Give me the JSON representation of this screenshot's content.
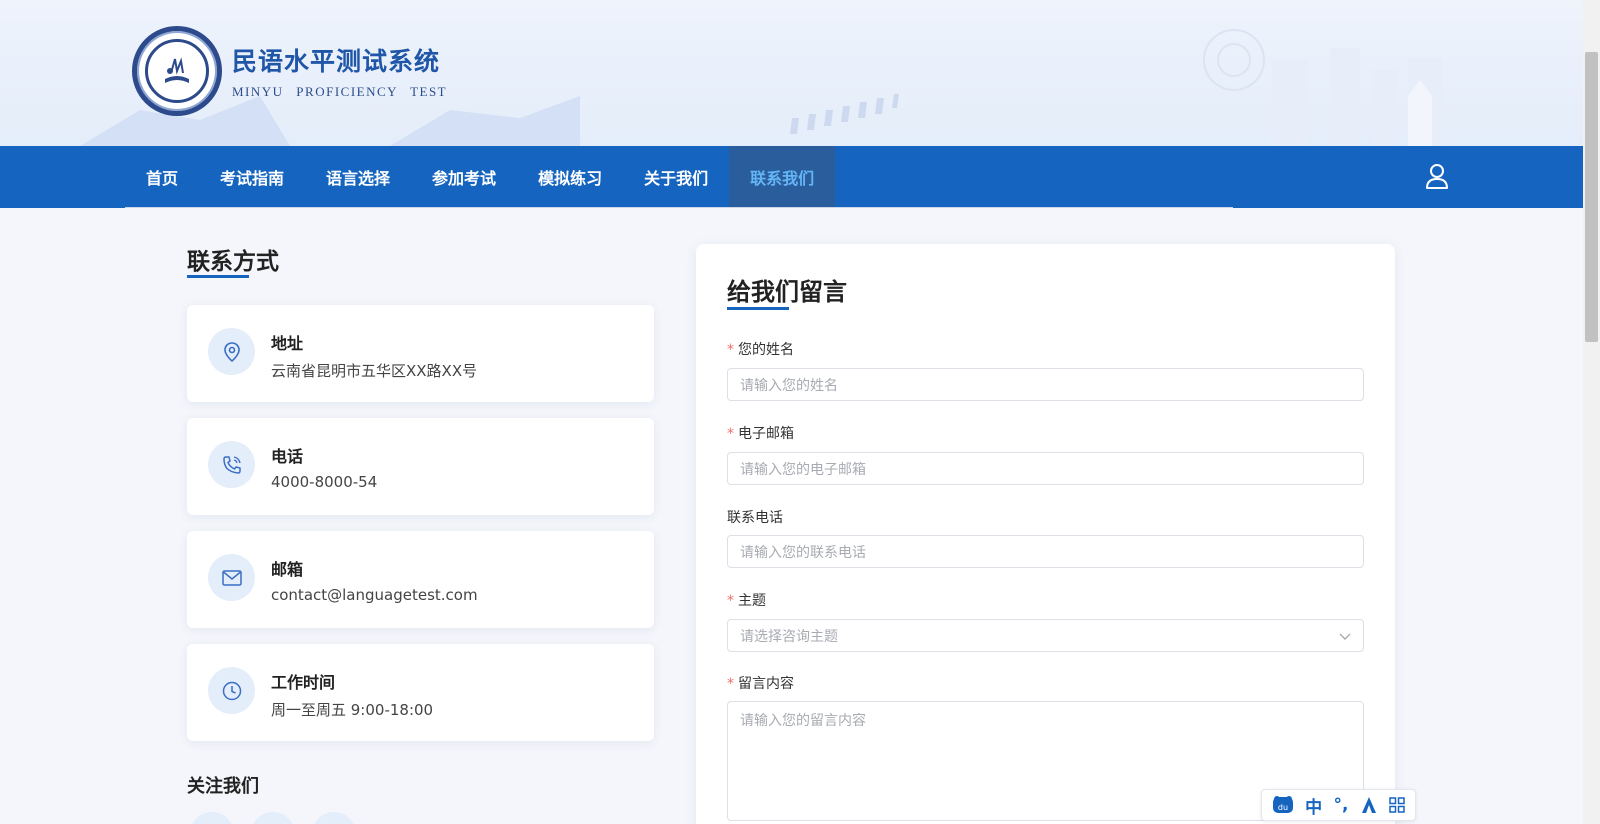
{
  "header": {
    "site_title_cn": "民语水平测试系统",
    "site_title_en": "MINYU   PROFICIENCY   TEST"
  },
  "nav": {
    "items": [
      {
        "label": "首页"
      },
      {
        "label": "考试指南"
      },
      {
        "label": "语言选择"
      },
      {
        "label": "参加考试"
      },
      {
        "label": "模拟练习"
      },
      {
        "label": "关于我们"
      },
      {
        "label": "联系我们",
        "active": true
      }
    ],
    "user_icon": "user-icon"
  },
  "contact": {
    "title": "联系方式",
    "cards": [
      {
        "icon": "location-pin-icon",
        "label": "地址",
        "value": "云南省昆明市五华区XX路XX号"
      },
      {
        "icon": "phone-icon",
        "label": "电话",
        "value": "4000-8000-54"
      },
      {
        "icon": "mail-icon",
        "label": "邮箱",
        "value": "contact@languagetest.com"
      },
      {
        "icon": "clock-icon",
        "label": "工作时间",
        "value": "周一至周五 9:00-18:00"
      }
    ],
    "follow_title": "关注我们"
  },
  "form": {
    "title": "给我们留言",
    "fields": {
      "name": {
        "label": "您的姓名",
        "required": true,
        "placeholder": "请输入您的姓名"
      },
      "email": {
        "label": "电子邮箱",
        "required": true,
        "placeholder": "请输入您的电子邮箱"
      },
      "phone": {
        "label": "联系电话",
        "required": false,
        "placeholder": "请输入您的联系电话"
      },
      "subject": {
        "label": "主题",
        "required": true,
        "placeholder": "请选择咨询主题"
      },
      "message": {
        "label": "留言内容",
        "required": true,
        "placeholder": "请输入您的留言内容"
      }
    },
    "required_mark": "*"
  },
  "ime": {
    "mode": "中",
    "punct": "°,"
  },
  "colors": {
    "primary": "#1565c0",
    "nav_active_text": "#64b5f6",
    "required": "#f56c6c"
  }
}
